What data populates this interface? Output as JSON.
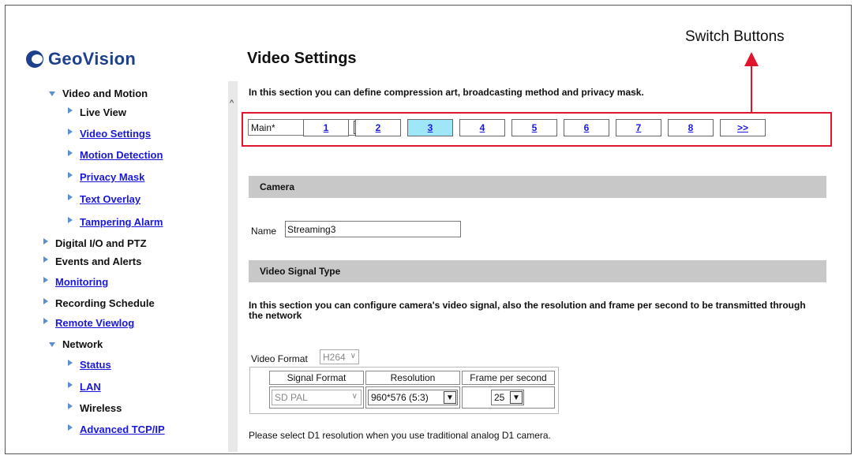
{
  "logo": {
    "text": "GeoVision"
  },
  "sidebar": {
    "items": [
      {
        "label": "Video and Motion",
        "marker": "down",
        "link": false
      },
      {
        "label": "Live View",
        "marker": "right",
        "link": false
      },
      {
        "label": "Video Settings",
        "marker": "right",
        "link": true
      },
      {
        "label": "Motion Detection",
        "marker": "right",
        "link": true
      },
      {
        "label": "Privacy Mask",
        "marker": "right",
        "link": true
      },
      {
        "label": "Text Overlay",
        "marker": "right",
        "link": true
      },
      {
        "label": "Tampering Alarm",
        "marker": "right",
        "link": true
      },
      {
        "label": "Digital I/O and PTZ",
        "marker": "right",
        "link": false
      },
      {
        "label": "Events and Alerts",
        "marker": "right",
        "link": false
      },
      {
        "label": "Monitoring",
        "marker": "right",
        "link": true
      },
      {
        "label": "Recording Schedule",
        "marker": "right",
        "link": false
      },
      {
        "label": "Remote Viewlog",
        "marker": "right",
        "link": true
      },
      {
        "label": "Network",
        "marker": "down",
        "link": false
      },
      {
        "label": "Status",
        "marker": "right",
        "link": true
      },
      {
        "label": "LAN",
        "marker": "right",
        "link": true
      },
      {
        "label": "Wireless",
        "marker": "right",
        "link": false
      },
      {
        "label": "Advanced TCP/IP",
        "marker": "right",
        "link": true
      }
    ]
  },
  "main": {
    "title": "Video Settings",
    "intro": "In this section you can define compression art, broadcasting method and privacy mask.",
    "stream_select": "Main*",
    "stream_tabs": [
      "1",
      "2",
      "3",
      "4",
      "5",
      "6",
      "7",
      "8",
      ">>"
    ],
    "active_tab": "3",
    "camera_section": "Camera",
    "name_label": "Name",
    "name_value": "Streaming3",
    "signal_section": "Video Signal Type",
    "signal_description": "In this section you can configure camera's video signal, also the resolution and frame per second to be transmitted through the network",
    "video_format_label": "Video Format",
    "video_format_value": "H264",
    "table_headers": [
      "Signal Format",
      "Resolution",
      "Frame per second"
    ],
    "signal_format_value": "SD PAL",
    "resolution_value": "960*576 (5:3)",
    "fps_value": "25",
    "footnote": "Please select D1 resolution when you use traditional analog D1 camera."
  },
  "annotation": {
    "label": "Switch Buttons",
    "color": "#e0142c"
  },
  "colors": {
    "link": "#1a18d8",
    "active_tab": "#9fe6f8",
    "section_bar": "#c8c8c8",
    "logo": "#1d3f8c"
  }
}
